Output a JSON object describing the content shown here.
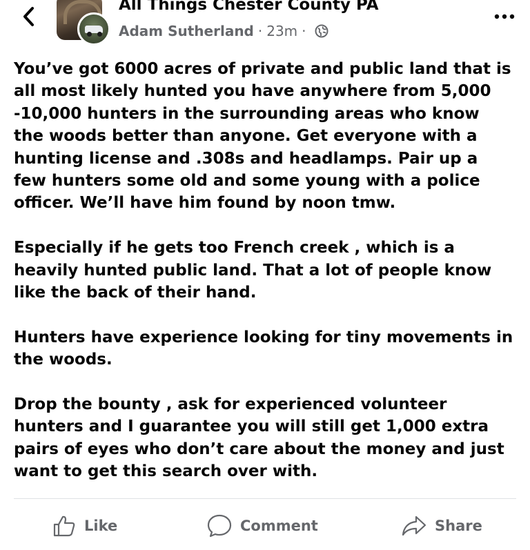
{
  "header": {
    "back_icon": "chevron-left-icon",
    "group_name": "All Things Chester County PA",
    "author": "Adam Sutherland",
    "separator": "·",
    "timestamp": "23m",
    "separator2": "·",
    "audience_icon": "globe-icon",
    "more_icon": "more-horizontal-icon"
  },
  "post": {
    "paragraphs": [
      "You’ve got 6000 acres of private and public land that is\nall most likely hunted you have anywhere from 5,000\n-10,000 hunters in the surrounding areas who know\nthe woods better than anyone. Get everyone with a\nhunting license and .308s and headlamps. Pair up a\nfew hunters some old and some young with a police\nofficer. We’ll have him found by noon tmw.",
      "Especially if he gets too French creek , which is a\nheavily hunted public land. That a lot of people know\nlike the back of their hand.",
      "Hunters have experience looking for tiny movements in\nthe woods.",
      "Drop the bounty , ask for experienced volunteer\nhunters and I guarantee you will still get 1,000 extra\npairs of eyes who don’t care about the money and just\nwant to get this search over with."
    ]
  },
  "actions": {
    "like_label": "Like",
    "like_icon": "thumbs-up-icon",
    "comment_label": "Comment",
    "comment_icon": "comment-bubble-icon",
    "share_label": "Share",
    "share_icon": "share-arrow-icon"
  },
  "colors": {
    "text_primary": "#050505",
    "text_secondary": "#65676b",
    "divider": "#dfe1e4",
    "background": "#ffffff"
  }
}
